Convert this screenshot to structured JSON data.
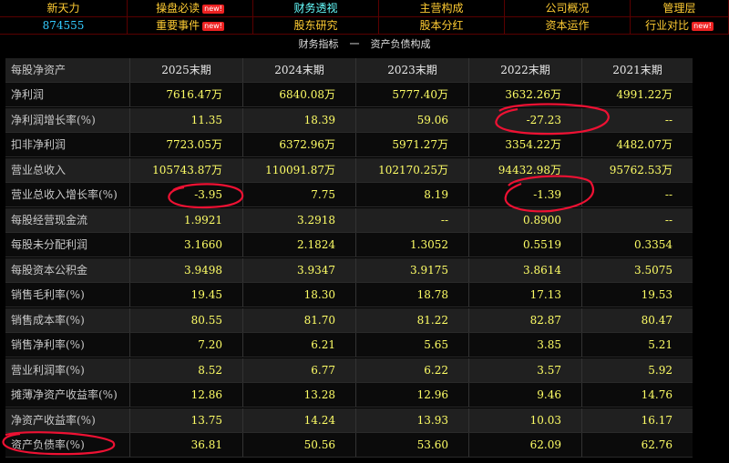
{
  "stock": {
    "name": "新天力",
    "code": "874555"
  },
  "nav_row1": [
    {
      "label": "操盘必读",
      "badge": "new!"
    },
    {
      "label": "财务透视",
      "badge": ""
    },
    {
      "label": "主营构成",
      "badge": ""
    },
    {
      "label": "公司概况",
      "badge": ""
    },
    {
      "label": "管理层",
      "badge": ""
    }
  ],
  "nav_row2": [
    {
      "label": "重要事件",
      "badge": "new!"
    },
    {
      "label": "股东研究",
      "badge": ""
    },
    {
      "label": "股本分红",
      "badge": ""
    },
    {
      "label": "资本运作",
      "badge": ""
    },
    {
      "label": "行业对比",
      "badge": "new!"
    }
  ],
  "subtitle": {
    "left": "财务指标",
    "sep": "一",
    "right": "资产负债构成"
  },
  "table": {
    "corner": "每股净资产",
    "periods": [
      "2025末期",
      "2024末期",
      "2023末期",
      "2022末期",
      "2021末期"
    ],
    "rows": [
      {
        "label": "净利润",
        "values": [
          "7616.47万",
          "6840.08万",
          "5777.40万",
          "3632.26万",
          "4991.22万"
        ]
      },
      {
        "label": "净利润增长率(%)",
        "values": [
          "11.35",
          "18.39",
          "59.06",
          "-27.23",
          "--"
        ]
      },
      {
        "label": "扣非净利润",
        "values": [
          "7723.05万",
          "6372.96万",
          "5971.27万",
          "3354.22万",
          "4482.07万"
        ]
      },
      {
        "label": "营业总收入",
        "values": [
          "105743.87万",
          "110091.87万",
          "102170.25万",
          "94432.98万",
          "95762.53万"
        ]
      },
      {
        "label": "营业总收入增长率(%)",
        "values": [
          "-3.95",
          "7.75",
          "8.19",
          "-1.39",
          "--"
        ]
      },
      {
        "label": "每股经营现金流",
        "values": [
          "1.9921",
          "3.2918",
          "--",
          "0.8900",
          "--"
        ]
      },
      {
        "label": "每股未分配利润",
        "values": [
          "3.1660",
          "2.1824",
          "1.3052",
          "0.5519",
          "0.3354"
        ]
      },
      {
        "label": "每股资本公积金",
        "values": [
          "3.9498",
          "3.9347",
          "3.9175",
          "3.8614",
          "3.5075"
        ]
      },
      {
        "label": "销售毛利率(%)",
        "values": [
          "19.45",
          "18.30",
          "18.78",
          "17.13",
          "19.53"
        ]
      },
      {
        "label": "销售成本率(%)",
        "values": [
          "80.55",
          "81.70",
          "81.22",
          "82.87",
          "80.47"
        ]
      },
      {
        "label": "销售净利率(%)",
        "values": [
          "7.20",
          "6.21",
          "5.65",
          "3.85",
          "5.21"
        ]
      },
      {
        "label": "营业利润率(%)",
        "values": [
          "8.52",
          "6.77",
          "6.22",
          "3.57",
          "5.92"
        ]
      },
      {
        "label": "摊薄净资产收益率(%)",
        "values": [
          "12.86",
          "13.28",
          "12.96",
          "9.46",
          "14.76"
        ]
      },
      {
        "label": "净资产收益率(%)",
        "values": [
          "13.75",
          "14.24",
          "13.93",
          "10.03",
          "16.17"
        ]
      },
      {
        "label": "资产负债率(%)",
        "values": [
          "36.81",
          "50.56",
          "53.60",
          "62.09",
          "62.76"
        ]
      }
    ]
  },
  "colors": {
    "value": "#ffff66",
    "label": "#c8c8c8",
    "nav_text": "#ffcc33",
    "annotation": "#ee1133"
  }
}
